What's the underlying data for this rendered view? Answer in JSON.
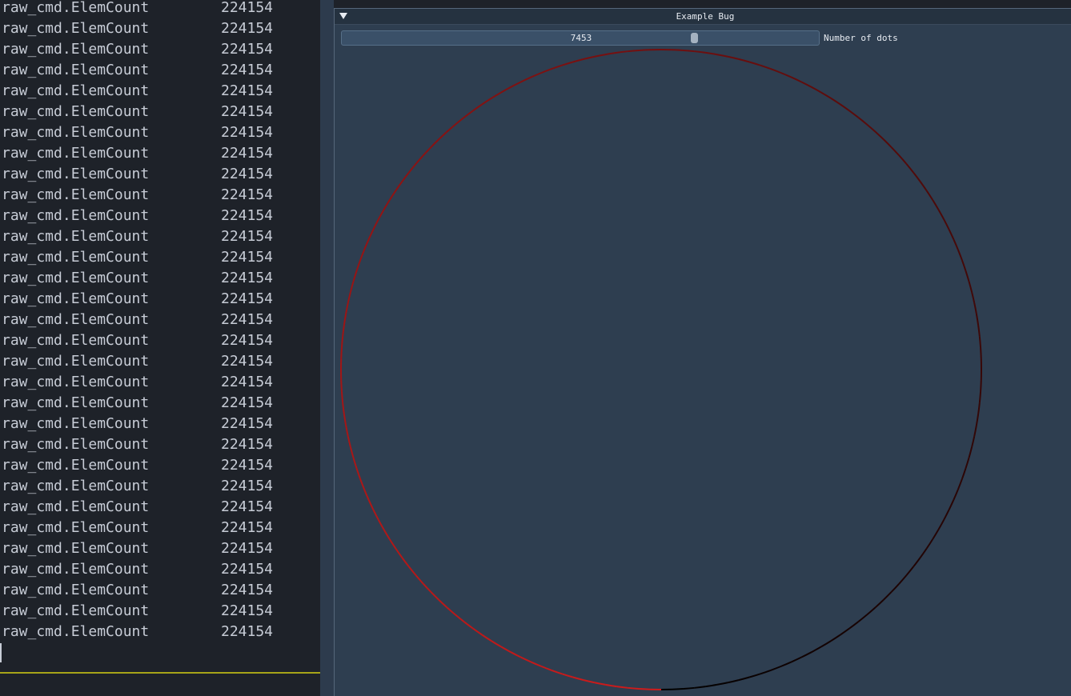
{
  "terminal": {
    "key_text": "raw_cmd.ElemCount",
    "lines": [
      {
        "key": "raw_cmd.ElemCount",
        "value": "224154"
      },
      {
        "key": "raw_cmd.ElemCount",
        "value": "224154"
      },
      {
        "key": "raw_cmd.ElemCount",
        "value": "224154"
      },
      {
        "key": "raw_cmd.ElemCount",
        "value": "224154"
      },
      {
        "key": "raw_cmd.ElemCount",
        "value": "224154"
      },
      {
        "key": "raw_cmd.ElemCount",
        "value": "224154"
      },
      {
        "key": "raw_cmd.ElemCount",
        "value": "224154"
      },
      {
        "key": "raw_cmd.ElemCount",
        "value": "224154"
      },
      {
        "key": "raw_cmd.ElemCount",
        "value": "224154"
      },
      {
        "key": "raw_cmd.ElemCount",
        "value": "224154"
      },
      {
        "key": "raw_cmd.ElemCount",
        "value": "224154"
      },
      {
        "key": "raw_cmd.ElemCount",
        "value": "224154"
      },
      {
        "key": "raw_cmd.ElemCount",
        "value": "224154"
      },
      {
        "key": "raw_cmd.ElemCount",
        "value": "224154"
      },
      {
        "key": "raw_cmd.ElemCount",
        "value": "224154"
      },
      {
        "key": "raw_cmd.ElemCount",
        "value": "224154"
      },
      {
        "key": "raw_cmd.ElemCount",
        "value": "224154"
      },
      {
        "key": "raw_cmd.ElemCount",
        "value": "224154"
      },
      {
        "key": "raw_cmd.ElemCount",
        "value": "224154"
      },
      {
        "key": "raw_cmd.ElemCount",
        "value": "224154"
      },
      {
        "key": "raw_cmd.ElemCount",
        "value": "224154"
      },
      {
        "key": "raw_cmd.ElemCount",
        "value": "224154"
      },
      {
        "key": "raw_cmd.ElemCount",
        "value": "224154"
      },
      {
        "key": "raw_cmd.ElemCount",
        "value": "224154"
      },
      {
        "key": "raw_cmd.ElemCount",
        "value": "224154"
      },
      {
        "key": "raw_cmd.ElemCount",
        "value": "224154"
      },
      {
        "key": "raw_cmd.ElemCount",
        "value": "224154"
      },
      {
        "key": "raw_cmd.ElemCount",
        "value": "224154"
      },
      {
        "key": "raw_cmd.ElemCount",
        "value": "224154"
      },
      {
        "key": "raw_cmd.ElemCount",
        "value": "224154"
      },
      {
        "key": "raw_cmd.ElemCount",
        "value": "224154"
      }
    ],
    "colors": {
      "background": "#1e2229",
      "text": "#c7ccd6",
      "divider": "#a7a418"
    }
  },
  "window": {
    "title": "Example Bug",
    "collapse_icon": "triangle-down-icon",
    "slider": {
      "value": "7453",
      "fraction": 0.745,
      "label": "Number of dots"
    },
    "circle": {
      "start_color": "#d01c1c",
      "end_color": "#000000",
      "colored_fraction": 0.5
    },
    "colors": {
      "background": "#2e3e50",
      "title_bar": "#253240",
      "slider_bg": "#3a5068",
      "grab": "#a4b2c1",
      "text": "#e8ecf2"
    }
  }
}
